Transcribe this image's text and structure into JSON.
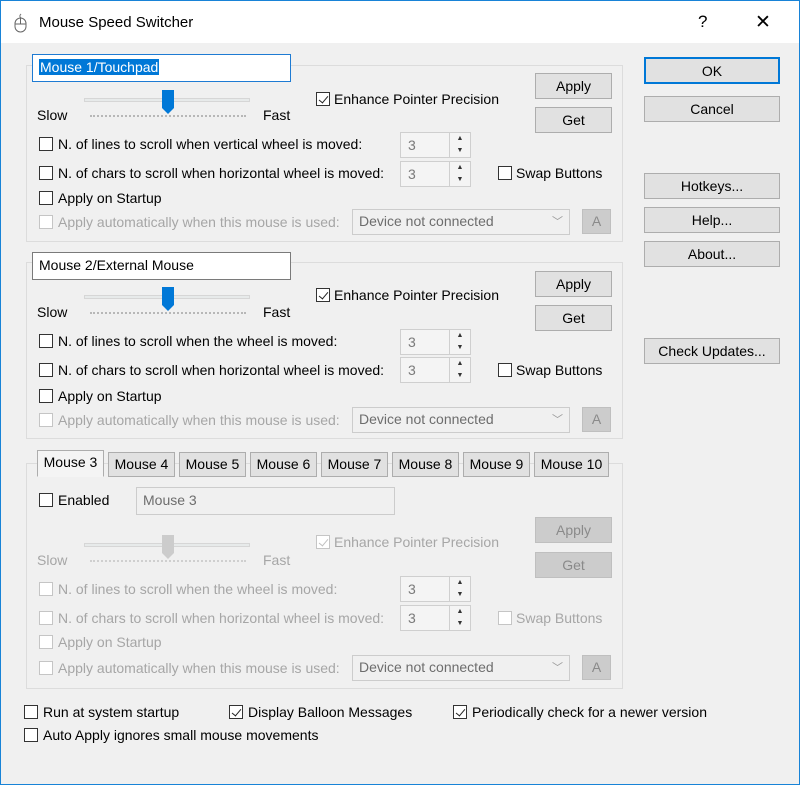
{
  "window": {
    "title": "Mouse Speed Switcher",
    "help_glyph": "?",
    "close_glyph": "✕",
    "accent": "#0078d7"
  },
  "dialog_buttons": {
    "ok": "OK",
    "cancel": "Cancel",
    "hotkeys": "Hotkeys...",
    "help": "Help...",
    "about": "About...",
    "check_updates": "Check Updates..."
  },
  "slider_labels": {
    "slow": "Slow",
    "fast": "Fast"
  },
  "mouse1": {
    "name": "Mouse 1/Touchpad",
    "enhance": "Enhance Pointer Precision",
    "enhance_checked": true,
    "apply": "Apply",
    "get": "Get",
    "speed_fraction": 0.5,
    "lines_label": "N. of lines to scroll when vertical wheel is moved:",
    "lines_value": "3",
    "chars_label": "N. of chars to scroll when  horizontal wheel is moved:",
    "chars_value": "3",
    "swap": "Swap Buttons",
    "startup": "Apply on Startup",
    "auto": "Apply automatically when this mouse is used:",
    "device": "Device not connected",
    "device_btn": "A"
  },
  "mouse2": {
    "name": "Mouse 2/External Mouse",
    "enhance": "Enhance Pointer Precision",
    "enhance_checked": true,
    "apply": "Apply",
    "get": "Get",
    "speed_fraction": 0.5,
    "lines_label": "N. of lines to scroll when the wheel is moved:",
    "lines_value": "3",
    "chars_label": "N. of chars to scroll when  horizontal wheel is moved:",
    "chars_value": "3",
    "swap": "Swap Buttons",
    "startup": "Apply on Startup",
    "auto": "Apply automatically when this mouse is used:",
    "device": "Device not connected",
    "device_btn": "A"
  },
  "tabs": [
    "Mouse 3",
    "Mouse 4",
    "Mouse 5",
    "Mouse 6",
    "Mouse 7",
    "Mouse 8",
    "Mouse 9",
    "Mouse 10"
  ],
  "mouse3": {
    "enabled": "Enabled",
    "name": "Mouse 3",
    "enhance": "Enhance Pointer Precision",
    "enhance_checked": true,
    "apply": "Apply",
    "get": "Get",
    "speed_fraction": 0.5,
    "lines_label": "N. of lines to scroll when the wheel is moved:",
    "lines_value": "3",
    "chars_label": "N. of chars to scroll when  horizontal wheel is moved:",
    "chars_value": "3",
    "swap": "Swap Buttons",
    "startup": "Apply on Startup",
    "auto": "Apply automatically when this mouse is used:",
    "device": "Device not connected",
    "device_btn": "A"
  },
  "global_options": {
    "run_startup": "Run at system startup",
    "balloon": "Display Balloon Messages",
    "balloon_checked": true,
    "periodic": "Periodically check for a newer version",
    "periodic_checked": true,
    "auto_apply": "Auto Apply ignores small mouse movements"
  }
}
